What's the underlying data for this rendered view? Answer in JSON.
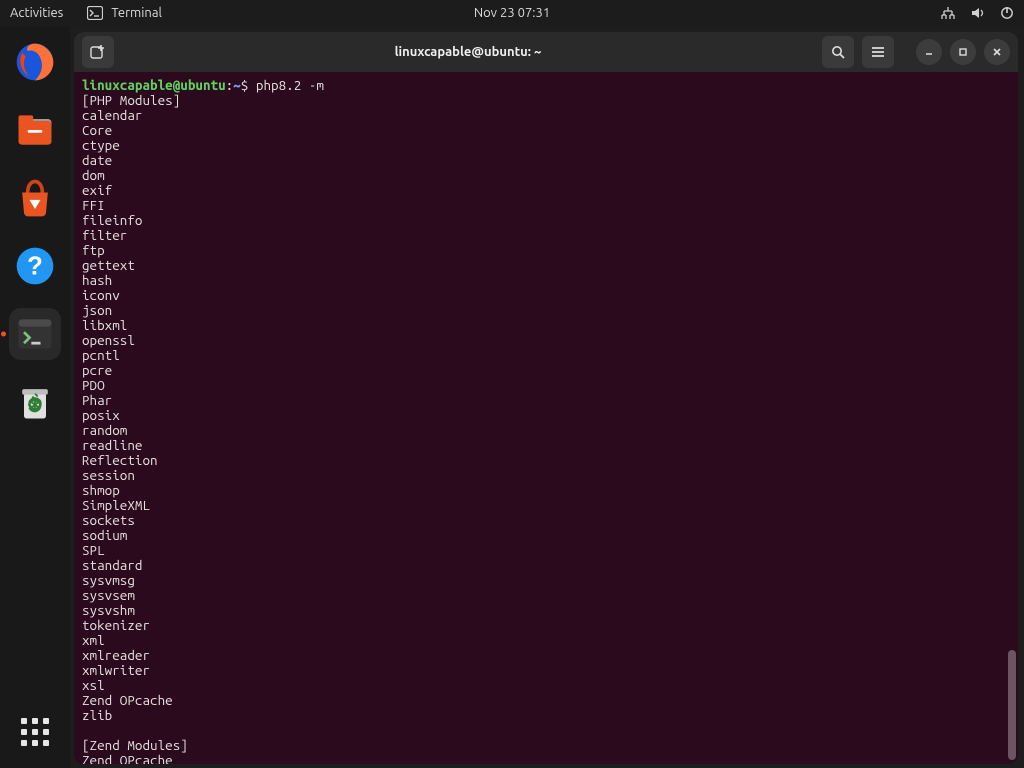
{
  "topbar": {
    "activities": "Activities",
    "appmenu_label": "Terminal",
    "clock": "Nov 23  07:31"
  },
  "dock": {
    "tooltip_terminal": "Terminal"
  },
  "window": {
    "title": "linuxcapable@ubuntu: ~"
  },
  "terminal": {
    "prompt_user": "linuxcapable@ubuntu",
    "prompt_sep": ":",
    "prompt_path": "~",
    "prompt_dollar": "$",
    "command": "php8.2 -m",
    "lines": [
      "[PHP Modules]",
      "calendar",
      "Core",
      "ctype",
      "date",
      "dom",
      "exif",
      "FFI",
      "fileinfo",
      "filter",
      "ftp",
      "gettext",
      "hash",
      "iconv",
      "json",
      "libxml",
      "openssl",
      "pcntl",
      "pcre",
      "PDO",
      "Phar",
      "posix",
      "random",
      "readline",
      "Reflection",
      "session",
      "shmop",
      "SimpleXML",
      "sockets",
      "sodium",
      "SPL",
      "standard",
      "sysvmsg",
      "sysvsem",
      "sysvshm",
      "tokenizer",
      "xml",
      "xmlreader",
      "xmlwriter",
      "xsl",
      "Zend OPcache",
      "zlib",
      "",
      "[Zend Modules]",
      "Zend OPcache"
    ]
  }
}
